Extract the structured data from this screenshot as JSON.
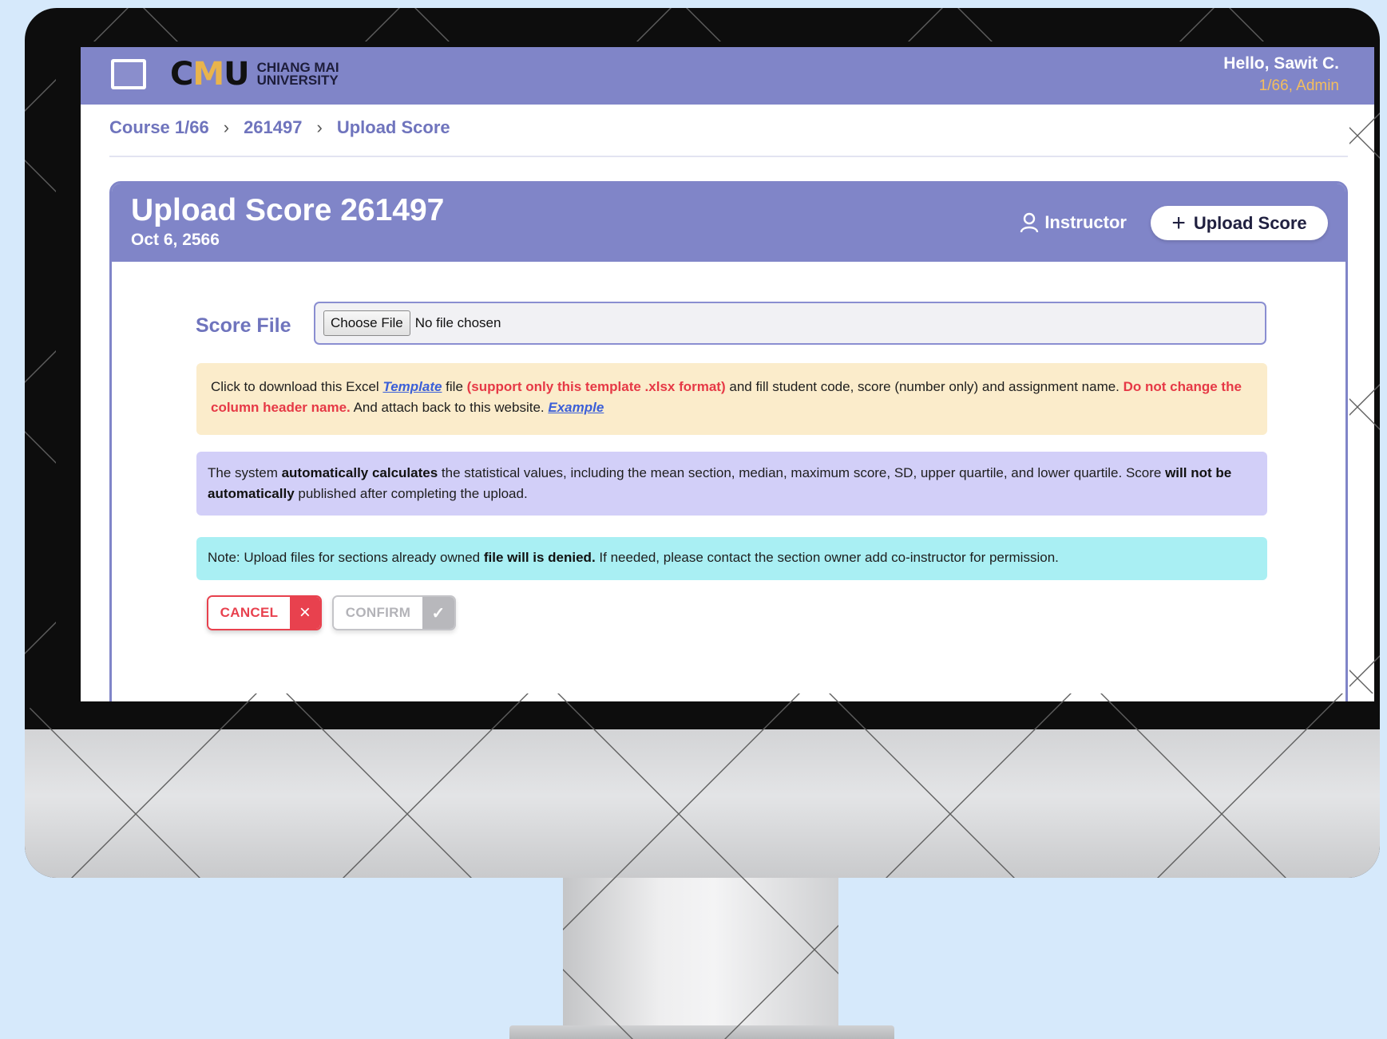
{
  "header": {
    "logo_mark_left": "C",
    "logo_mark_mid": "M",
    "logo_mark_right": "U",
    "logo_line1": "CHIANG MAI",
    "logo_line2": "UNIVERSITY",
    "greeting": "Hello, Sawit C.",
    "role": "1/66, Admin"
  },
  "breadcrumb": {
    "items": [
      "Course 1/66",
      "261497",
      "Upload Score"
    ],
    "separator": "›"
  },
  "card": {
    "title": "Upload Score 261497",
    "date": "Oct 6, 2566",
    "instructor_label": "Instructor",
    "upload_button": "Upload Score",
    "upload_icon": "+"
  },
  "form": {
    "score_label": "Score File",
    "choose_file": "Choose File",
    "file_status": "No file chosen"
  },
  "notice_template": {
    "p1": "Click to download this Excel ",
    "link_template": "Template",
    "p2": " file ",
    "red1": "(support only this template .xlsx format)",
    "p3": " and fill student code, score (number only) and assignment name. ",
    "red2": "Do not change the column header name.",
    "p4": " And attach back to this website. ",
    "link_example": "Example"
  },
  "notice_stats": {
    "p1": "The system ",
    "b1": "automatically calculates",
    "p2": " the statistical values, including the mean section, median, maximum score, SD, upper quartile, and lower quartile. Score ",
    "b2": "will not be automatically",
    "p3": " published after completing the upload."
  },
  "notice_owned": {
    "p1": "Note: Upload files for sections already owned ",
    "b1": "file will is denied.",
    "p2": " If needed, please contact the section owner add co-instructor for permission."
  },
  "actions": {
    "cancel": "CANCEL",
    "cancel_icon": "×",
    "confirm": "CONFIRM",
    "confirm_icon": "✓"
  },
  "colors": {
    "brand": "#8085c8",
    "accent_text": "#6f74bd",
    "danger": "#e8414e",
    "warning_bg": "#fbeccb",
    "info_bg": "#d2cff8",
    "note_bg": "#a9eff3",
    "page_bg": "#d6e9fb"
  }
}
